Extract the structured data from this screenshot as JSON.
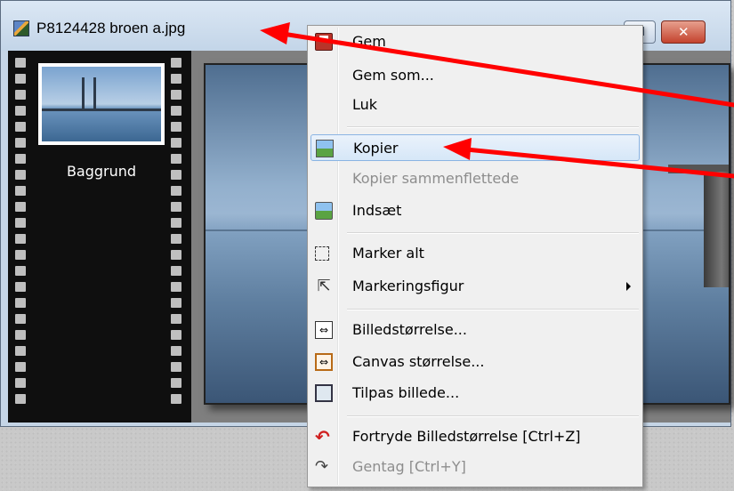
{
  "window": {
    "title": "P8124428 broen a.jpg",
    "close_glyph": "✕"
  },
  "filmstrip": {
    "layers": [
      {
        "label": "Baggrund"
      }
    ]
  },
  "context_menu": {
    "items": [
      {
        "label": "Gem",
        "icon": "save-icon",
        "enabled": true
      },
      {
        "label": "Gem som...",
        "icon": "",
        "enabled": true
      },
      {
        "label": "Luk",
        "icon": "",
        "enabled": true
      },
      {
        "label": "Kopier",
        "icon": "copy-image-icon",
        "enabled": true,
        "highlighted": true
      },
      {
        "label": "Kopier sammenflettede",
        "icon": "",
        "enabled": false
      },
      {
        "label": "Indsæt",
        "icon": "paste-image-icon",
        "enabled": true
      },
      {
        "label": "Marker alt",
        "icon": "select-all-icon",
        "enabled": true
      },
      {
        "label": "Markeringsfigur",
        "icon": "cursor-icon",
        "enabled": true,
        "submenu": true
      },
      {
        "label": "Billedstørrelse...",
        "icon": "image-size-icon",
        "enabled": true
      },
      {
        "label": "Canvas størrelse...",
        "icon": "canvas-size-icon",
        "enabled": true
      },
      {
        "label": "Tilpas billede...",
        "icon": "fit-image-icon",
        "enabled": true
      },
      {
        "label": "Fortryde Billedstørrelse [Ctrl+Z]",
        "icon": "undo-icon",
        "enabled": true
      },
      {
        "label": "Gentag [Ctrl+Y]",
        "icon": "redo-icon",
        "enabled": false
      }
    ]
  },
  "colors": {
    "annotation_arrow": "#ff0000",
    "menu_highlight_border": "#8ab4e3"
  }
}
